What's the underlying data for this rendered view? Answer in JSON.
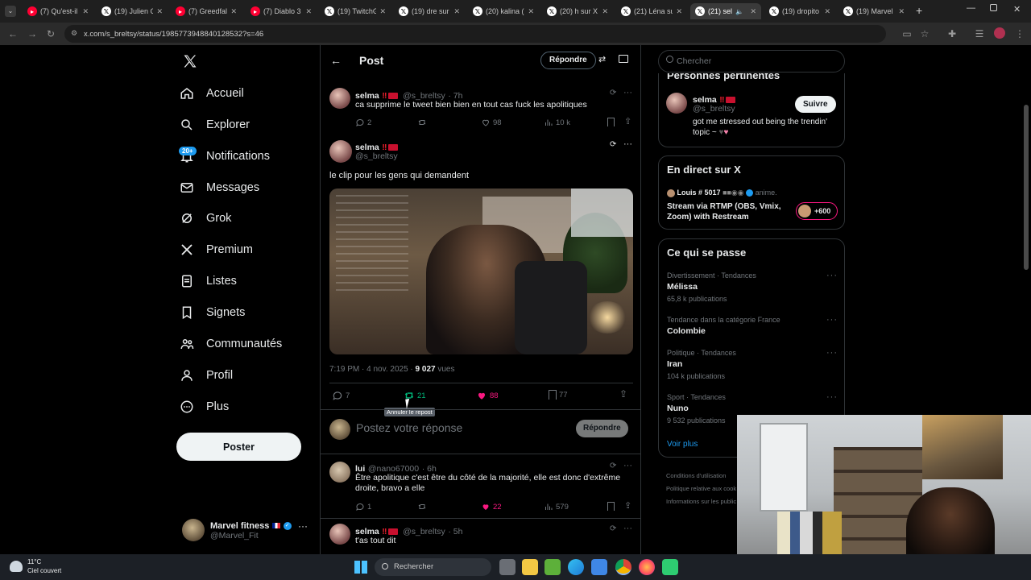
{
  "browser": {
    "tabs": [
      {
        "title": "(7) Qu'est-il",
        "fav": "youtube",
        "color": "#ff0033"
      },
      {
        "title": "(19) Julien C",
        "fav": "x",
        "color": "#000000"
      },
      {
        "title": "(7) Greedfall",
        "fav": "youtube",
        "color": "#ff0033"
      },
      {
        "title": "(7) Diablo 3",
        "fav": "youtube",
        "color": "#ff0033"
      },
      {
        "title": "(19) TwitchG",
        "fav": "x",
        "color": "#000000"
      },
      {
        "title": "(19) dre sur",
        "fav": "x",
        "color": "#000000"
      },
      {
        "title": "(20) kalina (",
        "fav": "x",
        "color": "#000000"
      },
      {
        "title": "(20) h sur X",
        "fav": "x",
        "color": "#000000"
      },
      {
        "title": "(21) Léna su",
        "fav": "x",
        "color": "#000000"
      },
      {
        "title": "(21) sel",
        "fav": "x",
        "color": "#000000",
        "active": true
      },
      {
        "title": "(19) dropito",
        "fav": "x",
        "color": "#000000"
      },
      {
        "title": "(19) Marvel",
        "fav": "x",
        "color": "#000000"
      }
    ],
    "new_tab": "+",
    "url": "x.com/s_breltsy/status/1985773948840128532?s=46"
  },
  "nav": {
    "logo": "X",
    "items": [
      {
        "label": "Accueil",
        "icon": "home-icon"
      },
      {
        "label": "Explorer",
        "icon": "search-icon"
      },
      {
        "label": "Notifications",
        "icon": "bell-icon",
        "badge": "20+"
      },
      {
        "label": "Messages",
        "icon": "mail-icon"
      },
      {
        "label": "Grok",
        "icon": "grok-icon"
      },
      {
        "label": "Premium",
        "icon": "x-icon"
      },
      {
        "label": "Listes",
        "icon": "list-icon"
      },
      {
        "label": "Signets",
        "icon": "bookmark-icon"
      },
      {
        "label": "Communautés",
        "icon": "people-icon"
      },
      {
        "label": "Profil",
        "icon": "person-icon"
      },
      {
        "label": "Plus",
        "icon": "more-circle-icon"
      }
    ],
    "post_button": "Poster",
    "account": {
      "name": "Marvel fitness",
      "handle": "@Marvel_Fit"
    }
  },
  "header": {
    "title": "Post",
    "reply_button": "Répondre"
  },
  "tweets": {
    "parent": {
      "name": "selma",
      "handle": "@s_breltsy",
      "time": "· 7h",
      "text": "ca supprime le tweet bien bien en tout cas fuck les apolitiques",
      "replies": "2",
      "likes": "98",
      "views": "10 k"
    },
    "main": {
      "name": "selma",
      "handle": "@s_breltsy",
      "text": "le clip pour les gens qui demandent",
      "timestamp": "7:19 PM · 4 nov. 2025 ·",
      "views_count": "9 027",
      "views_label": "vues",
      "replies": "7",
      "reposts": "21",
      "likes": "88",
      "bookmarks": "77",
      "tooltip": "Annuler le repost"
    },
    "reply_placeholder": "Postez votre réponse",
    "reply_button": "Répondre",
    "replies": [
      {
        "name": "lui",
        "handle": "@nano67000",
        "time": "· 6h",
        "text": "Être apolitique c'est être du côté de la majorité, elle est donc d'extrême droite, bravo a elle",
        "replies": "1",
        "likes": "22",
        "views": "579"
      },
      {
        "name": "selma",
        "handle": "@s_breltsy",
        "time": "· 5h",
        "text": "t'as tout dit"
      }
    ]
  },
  "right": {
    "search_placeholder": "Chercher",
    "relevant": {
      "title": "Personnes pertinentes",
      "name": "selma",
      "handle": "@s_breltsy",
      "follow": "Suivre",
      "bio": "got me stressed out being the trendin' topic ~"
    },
    "live": {
      "title": "En direct sur X",
      "host": "Louis # 5017",
      "host_suffix": "anime.",
      "text": "Stream via RTMP (OBS, Vmix, Zoom) with Restream",
      "count": "+600"
    },
    "trends": {
      "title": "Ce qui se passe",
      "items": [
        {
          "meta": "Divertissement · Tendances",
          "name": "Mélissa",
          "count": "65,8 k publications"
        },
        {
          "meta": "Tendance dans la catégorie France",
          "name": "Colombie",
          "count": ""
        },
        {
          "meta": "Politique · Tendances",
          "name": "Iran",
          "count": "104 k publications"
        },
        {
          "meta": "Sport · Tendances",
          "name": "Nuno",
          "count": "9 532 publications"
        }
      ],
      "more": "Voir plus"
    },
    "footer": [
      "Conditions d'utilisation",
      "Politique relative aux cook",
      "Informations sur les public"
    ]
  },
  "taskbar": {
    "weather_temp": "11°C",
    "weather_desc": "Ciel couvert",
    "search": "Rechercher"
  },
  "colors": {
    "accent": "#1d9bf0",
    "like": "#f91880",
    "repost": "#00ba7c"
  }
}
